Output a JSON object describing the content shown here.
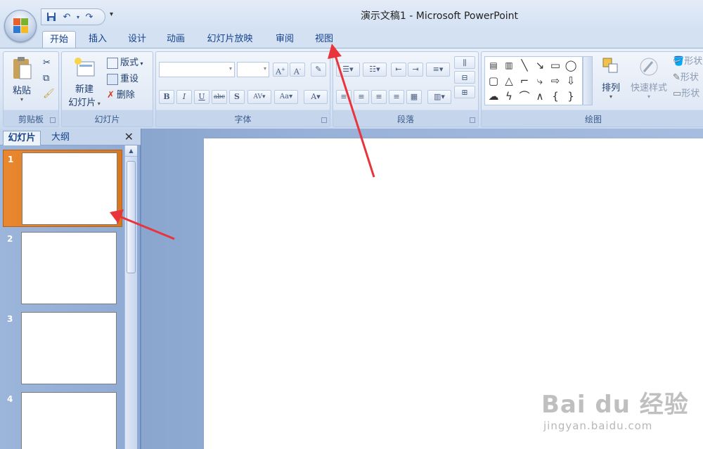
{
  "window": {
    "title": "演示文稿1 - Microsoft PowerPoint"
  },
  "tabs": [
    {
      "label": "开始",
      "active": true
    },
    {
      "label": "插入"
    },
    {
      "label": "设计"
    },
    {
      "label": "动画"
    },
    {
      "label": "幻灯片放映"
    },
    {
      "label": "审阅"
    },
    {
      "label": "视图"
    }
  ],
  "ribbon": {
    "clipboard": {
      "group_label": "剪贴板",
      "paste_label": "粘贴"
    },
    "slides": {
      "group_label": "幻灯片",
      "new_slide_label_line1": "新建",
      "new_slide_label_line2": "幻灯片",
      "layout_label": "版式",
      "reset_label": "重设",
      "delete_label": "删除"
    },
    "font": {
      "group_label": "字体"
    },
    "paragraph": {
      "group_label": "段落"
    },
    "drawing": {
      "group_label": "绘图",
      "arrange_label": "排列",
      "quick_styles_label": "快速样式",
      "shape_fill_label": "形状",
      "shape_outline_label": "形状",
      "shape_effect_label": "形状"
    }
  },
  "pane": {
    "tab_slides": "幻灯片",
    "tab_outline": "大纲",
    "close_glyph": "✕",
    "slides": [
      {
        "number": "1",
        "selected": true
      },
      {
        "number": "2"
      },
      {
        "number": "3"
      },
      {
        "number": "4"
      }
    ]
  },
  "watermark": {
    "main": "Bai du 经验",
    "sub": "jingyan.baidu.com"
  },
  "colors": {
    "arrow": "#e8343a",
    "selected_slide": "#e9872f",
    "ribbon_bg": "#dbe6f5"
  }
}
